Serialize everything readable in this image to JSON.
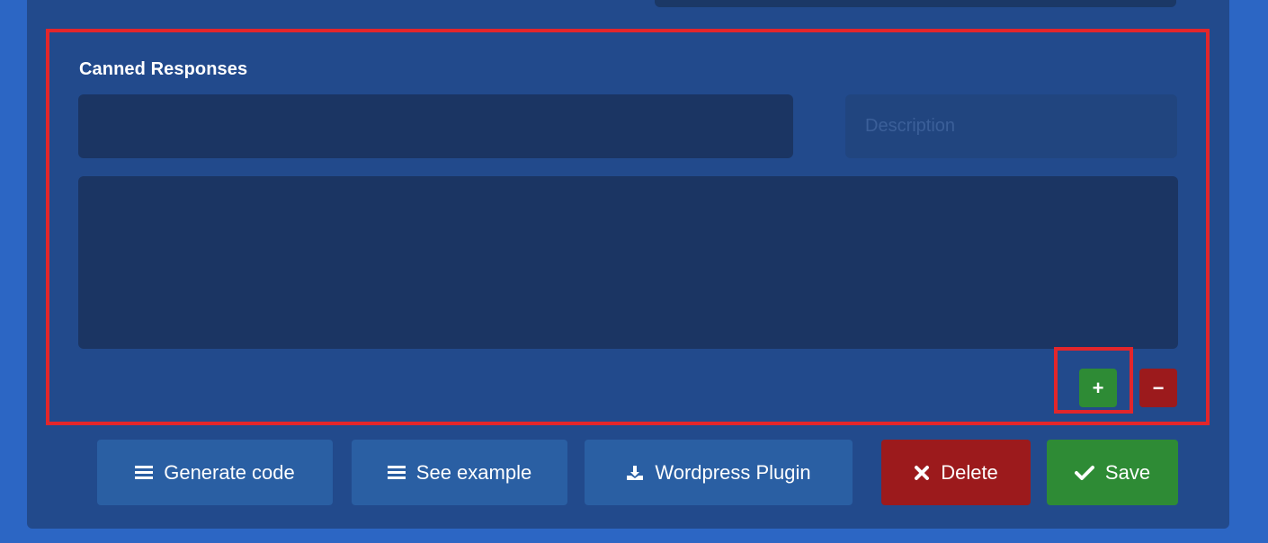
{
  "section": {
    "title": "Canned Responses"
  },
  "fields": {
    "name_value": "",
    "description_placeholder": "Description",
    "description_value": "",
    "text_value": ""
  },
  "row_controls": {
    "add_label": "+",
    "remove_label": "−"
  },
  "actions": {
    "generate_code": "Generate code",
    "see_example": "See example",
    "wordpress_plugin": "Wordpress Plugin",
    "delete": "Delete",
    "save": "Save"
  },
  "icons": {
    "generate_code": "list-icon",
    "see_example": "list-icon",
    "wordpress_plugin": "download-icon",
    "delete": "x-icon",
    "save": "check-icon"
  },
  "colors": {
    "background": "#2c66c4",
    "panel": "#224a8c",
    "field": "#1b3563",
    "highlight": "#e3262b",
    "button_blue": "#2a5fa3",
    "button_red": "#9c1a1c",
    "button_green": "#2e8b35"
  }
}
